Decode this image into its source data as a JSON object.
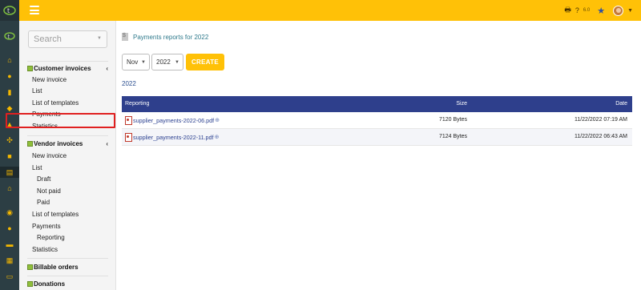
{
  "topbar": {
    "version": "6.0"
  },
  "search": {
    "placeholder": "Search"
  },
  "sidebar": {
    "customer_invoices": {
      "title": "Customer invoices",
      "items": [
        "New invoice",
        "List",
        "List of templates",
        "Payments",
        "Statistics"
      ]
    },
    "vendor_invoices": {
      "title": "Vendor invoices",
      "items": [
        "New invoice",
        "List",
        "Draft",
        "Not paid",
        "Paid",
        "List of templates",
        "Payments",
        "Reporting",
        "Statistics"
      ]
    },
    "billable_orders": {
      "title": "Billable orders"
    },
    "donations": {
      "title": "Donations"
    }
  },
  "main": {
    "title": "Payments reports for 2022",
    "month_select": "Nov",
    "year_select": "2022",
    "create_label": "CREATE",
    "year_link": "2022",
    "table": {
      "headers": {
        "reporting": "Reporting",
        "size": "Size",
        "date": "Date"
      },
      "rows": [
        {
          "file": "supplier_payments-2022-06.pdf",
          "size": "7120 Bytes",
          "date": "11/22/2022 07:19 AM"
        },
        {
          "file": "supplier_payments-2022-11.pdf",
          "size": "7124 Bytes",
          "date": "11/22/2022 06:43 AM"
        }
      ]
    }
  },
  "colors": {
    "accent": "#ffc107",
    "table_header": "#2e3f8c",
    "rail": "#2c3e44",
    "highlight": "#e02020"
  },
  "icons": [
    "logo-icon",
    "home-icon",
    "user-icon",
    "document-icon",
    "package-icon",
    "chart-icon",
    "nodes-icon",
    "briefcase-icon",
    "invoice-icon",
    "bank-icon",
    "search-icon",
    "person-icon",
    "folder-icon",
    "calendar-icon",
    "card-icon",
    "printer-icon",
    "help-icon",
    "star-icon"
  ]
}
